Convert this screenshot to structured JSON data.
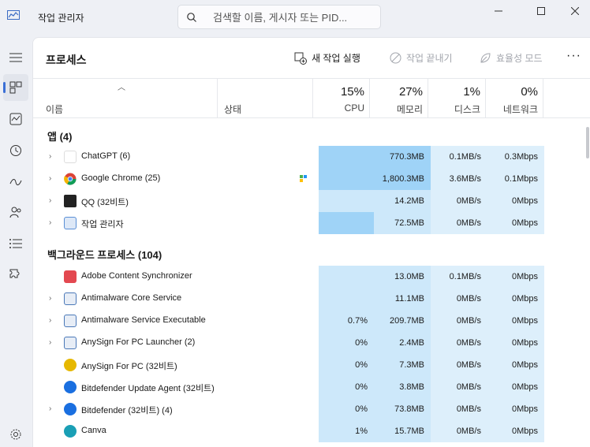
{
  "window": {
    "title": "작업 관리자",
    "search_placeholder": "검색할 이름, 게시자 또는 PID..."
  },
  "rail": {
    "items": [
      "menu-icon",
      "processes-icon",
      "performance-icon",
      "app-history-icon",
      "startup-apps-icon",
      "users-icon",
      "details-icon",
      "services-icon",
      "settings-icon"
    ]
  },
  "header": {
    "page_title": "프로세스",
    "new_task": "새 작업 실행",
    "end_task": "작업 끝내기",
    "efficiency": "효율성 모드",
    "more": "···"
  },
  "columns": {
    "name": "이름",
    "status": "상태",
    "cpu_pct": "15%",
    "cpu": "CPU",
    "mem_pct": "27%",
    "mem": "메모리",
    "disk_pct": "1%",
    "disk": "디스크",
    "net_pct": "0%",
    "net": "네트워크"
  },
  "groups": {
    "apps": "앱 (4)",
    "background": "백그라운드 프로세스 (104)"
  },
  "apps": [
    {
      "name": "ChatGPT (6)",
      "icon": "chatgpt-icon",
      "icon_color": "#ffffff",
      "cpu": "",
      "mem": "770.3MB",
      "disk": "0.1MB/s",
      "net": "0.3Mbps"
    },
    {
      "name": "Google Chrome (25)",
      "icon": "chrome-icon",
      "icon_color": "#db4437",
      "cpu": "",
      "mem": "1,800.3MB",
      "disk": "3.6MB/s",
      "net": "0.1Mbps"
    },
    {
      "name": "QQ (32비트)",
      "icon": "qq-icon",
      "icon_color": "#222222",
      "cpu": "",
      "mem": "14.2MB",
      "disk": "0MB/s",
      "net": "0Mbps"
    },
    {
      "name": "작업 관리자",
      "icon": "taskmgr-icon",
      "icon_color": "#5a8fd6",
      "cpu": "",
      "mem": "72.5MB",
      "disk": "0MB/s",
      "net": "0Mbps"
    }
  ],
  "background": [
    {
      "name": "Adobe Content Synchronizer",
      "icon": "adobe-icon",
      "icon_color": "#e34850",
      "cpu": "",
      "mem": "13.0MB",
      "disk": "0.1MB/s",
      "net": "0Mbps"
    },
    {
      "name": "Antimalware Core Service",
      "icon": "shield-icon",
      "icon_color": "#4a78b8",
      "cpu": "",
      "mem": "11.1MB",
      "disk": "0MB/s",
      "net": "0Mbps"
    },
    {
      "name": "Antimalware Service Executable",
      "icon": "shield-icon",
      "icon_color": "#4a78b8",
      "cpu": "0.7%",
      "mem": "209.7MB",
      "disk": "0MB/s",
      "net": "0Mbps"
    },
    {
      "name": "AnySign For PC Launcher (2)",
      "icon": "anysign-icon",
      "icon_color": "#4a78b8",
      "cpu": "0%",
      "mem": "2.4MB",
      "disk": "0MB/s",
      "net": "0Mbps"
    },
    {
      "name": "AnySign For PC (32비트)",
      "icon": "anysign-icon",
      "icon_color": "#e6b800",
      "cpu": "0%",
      "mem": "7.3MB",
      "disk": "0MB/s",
      "net": "0Mbps"
    },
    {
      "name": "Bitdefender Update Agent (32비트)",
      "icon": "bitdefender-icon",
      "icon_color": "#1a6fe0",
      "cpu": "0%",
      "mem": "3.8MB",
      "disk": "0MB/s",
      "net": "0Mbps"
    },
    {
      "name": "Bitdefender (32비트) (4)",
      "icon": "bitdefender-icon",
      "icon_color": "#1a6fe0",
      "cpu": "0%",
      "mem": "73.8MB",
      "disk": "0MB/s",
      "net": "0Mbps"
    },
    {
      "name": "Canva",
      "icon": "canva-icon",
      "icon_color": "#1a9fb5",
      "cpu": "1%",
      "mem": "15.7MB",
      "disk": "0MB/s",
      "net": "0Mbps"
    }
  ]
}
